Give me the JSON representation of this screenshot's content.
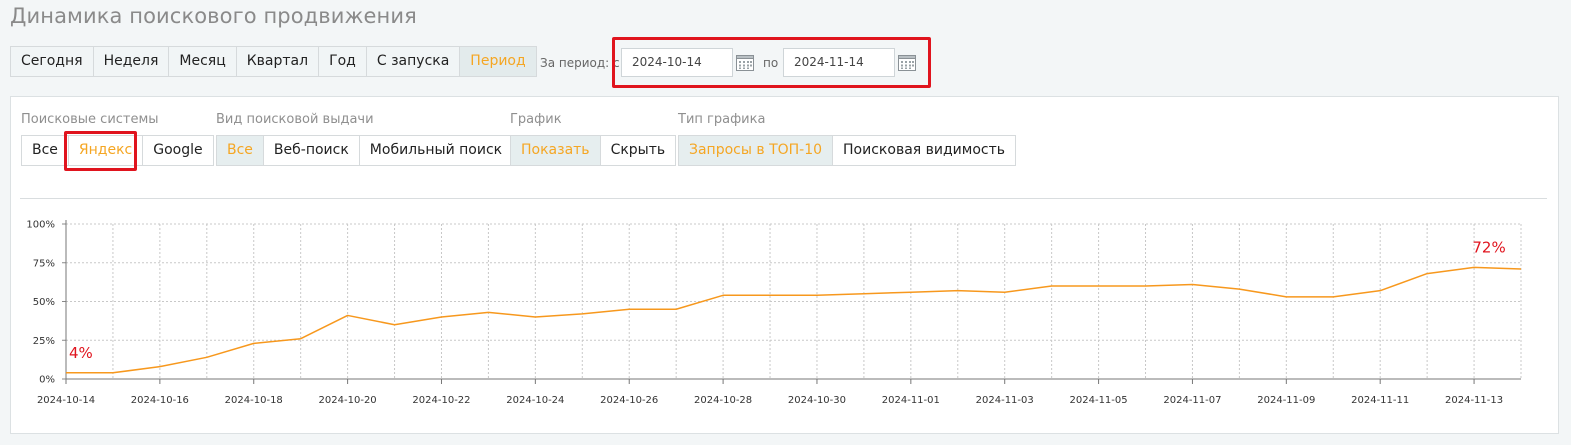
{
  "page": {
    "title": "Динамика поискового продвижения"
  },
  "period_tabs": {
    "items": [
      "Сегодня",
      "Неделя",
      "Месяц",
      "Квартал",
      "Год",
      "С запуска",
      "Период"
    ],
    "active_index": 6
  },
  "date_range": {
    "label_from": "За период: с",
    "label_to": "по",
    "from_value": "2024-10-14",
    "to_value": "2024-11-14"
  },
  "filters": {
    "search_engines": {
      "label": "Поисковые системы",
      "options": [
        "Все",
        "Яндекс",
        "Google"
      ],
      "active_index": 1
    },
    "serp_type": {
      "label": "Вид поисковой выдачи",
      "options": [
        "Все",
        "Веб-поиск",
        "Мобильный поиск"
      ],
      "active_index": 0
    },
    "chart_toggle": {
      "label": "График",
      "options": [
        "Показать",
        "Скрыть"
      ],
      "active_index": 0
    },
    "chart_type": {
      "label": "Тип графика",
      "options": [
        "Запросы в ТОП-10",
        "Поисковая видимость"
      ],
      "active_index": 0
    }
  },
  "colors": {
    "accent": "#f5a623",
    "line": "#f7981d",
    "highlight": "#e0141e",
    "grid": "#c8c8c8"
  },
  "chart_data": {
    "type": "line",
    "x": [
      "2024-10-14",
      "2024-10-15",
      "2024-10-16",
      "2024-10-17",
      "2024-10-18",
      "2024-10-19",
      "2024-10-20",
      "2024-10-21",
      "2024-10-22",
      "2024-10-23",
      "2024-10-24",
      "2024-10-25",
      "2024-10-26",
      "2024-10-27",
      "2024-10-28",
      "2024-10-29",
      "2024-10-30",
      "2024-10-31",
      "2024-11-01",
      "2024-11-02",
      "2024-11-03",
      "2024-11-04",
      "2024-11-05",
      "2024-11-06",
      "2024-11-07",
      "2024-11-08",
      "2024-11-09",
      "2024-11-10",
      "2024-11-11",
      "2024-11-12",
      "2024-11-13",
      "2024-11-14"
    ],
    "series": [
      {
        "values": [
          4,
          4,
          8,
          14,
          23,
          26,
          41,
          35,
          40,
          43,
          40,
          42,
          45,
          45,
          54,
          54,
          54,
          55,
          56,
          57,
          56,
          60,
          60,
          60,
          61,
          58,
          53,
          53,
          57,
          68,
          72,
          71
        ]
      }
    ],
    "x_tick_labels": [
      "2024-10-14",
      "2024-10-16",
      "2024-10-18",
      "2024-10-20",
      "2024-10-22",
      "2024-10-24",
      "2024-10-26",
      "2024-10-28",
      "2024-10-30",
      "2024-11-01",
      "2024-11-03",
      "2024-11-05",
      "2024-11-07",
      "2024-11-09",
      "2024-11-11",
      "2024-11-13"
    ],
    "y_tick_labels": [
      "0%",
      "25%",
      "50%",
      "75%",
      "100%"
    ],
    "ylim": [
      0,
      100
    ],
    "grid": true,
    "annotations": [
      {
        "text": "4%",
        "x": "2024-10-14",
        "y": 4
      },
      {
        "text": "72%",
        "x": "2024-11-13",
        "y": 72
      }
    ]
  }
}
